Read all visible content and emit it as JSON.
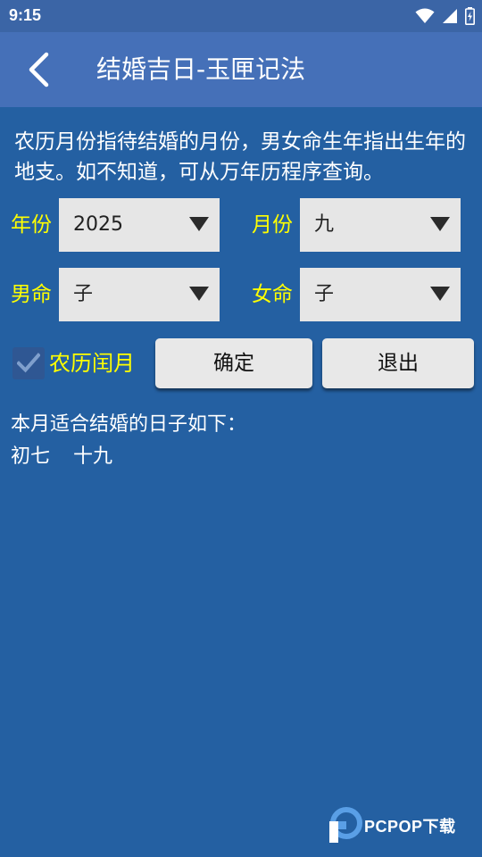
{
  "status_bar": {
    "time": "9:15",
    "icons": [
      "wifi-icon",
      "signal-icon",
      "battery-icon"
    ]
  },
  "app_bar": {
    "title": "结婚吉日-玉匣记法",
    "back_icon": "chevron-left-icon"
  },
  "intro_text": "农历月份指待结婚的月份，男女命生年指出生年的地支。如不知道，可从万年历程序查询。",
  "form": {
    "year": {
      "label": "年份",
      "value": "2025"
    },
    "month": {
      "label": "月份",
      "value": "九"
    },
    "male": {
      "label": "男命",
      "value": "子"
    },
    "female": {
      "label": "女命",
      "value": "子"
    },
    "leap_month": {
      "label": "农历闰月",
      "checked": true
    }
  },
  "buttons": {
    "confirm": "确定",
    "exit": "退出"
  },
  "result": {
    "title": "本月适合结婚的日子如下：",
    "days": [
      "初七",
      "十九"
    ]
  },
  "watermark": {
    "text": "PCPOP下载"
  },
  "colors": {
    "background": "#2460a2",
    "app_bar": "#4570b8",
    "status_bar": "#3b65a6",
    "label_yellow": "#ffff00"
  }
}
